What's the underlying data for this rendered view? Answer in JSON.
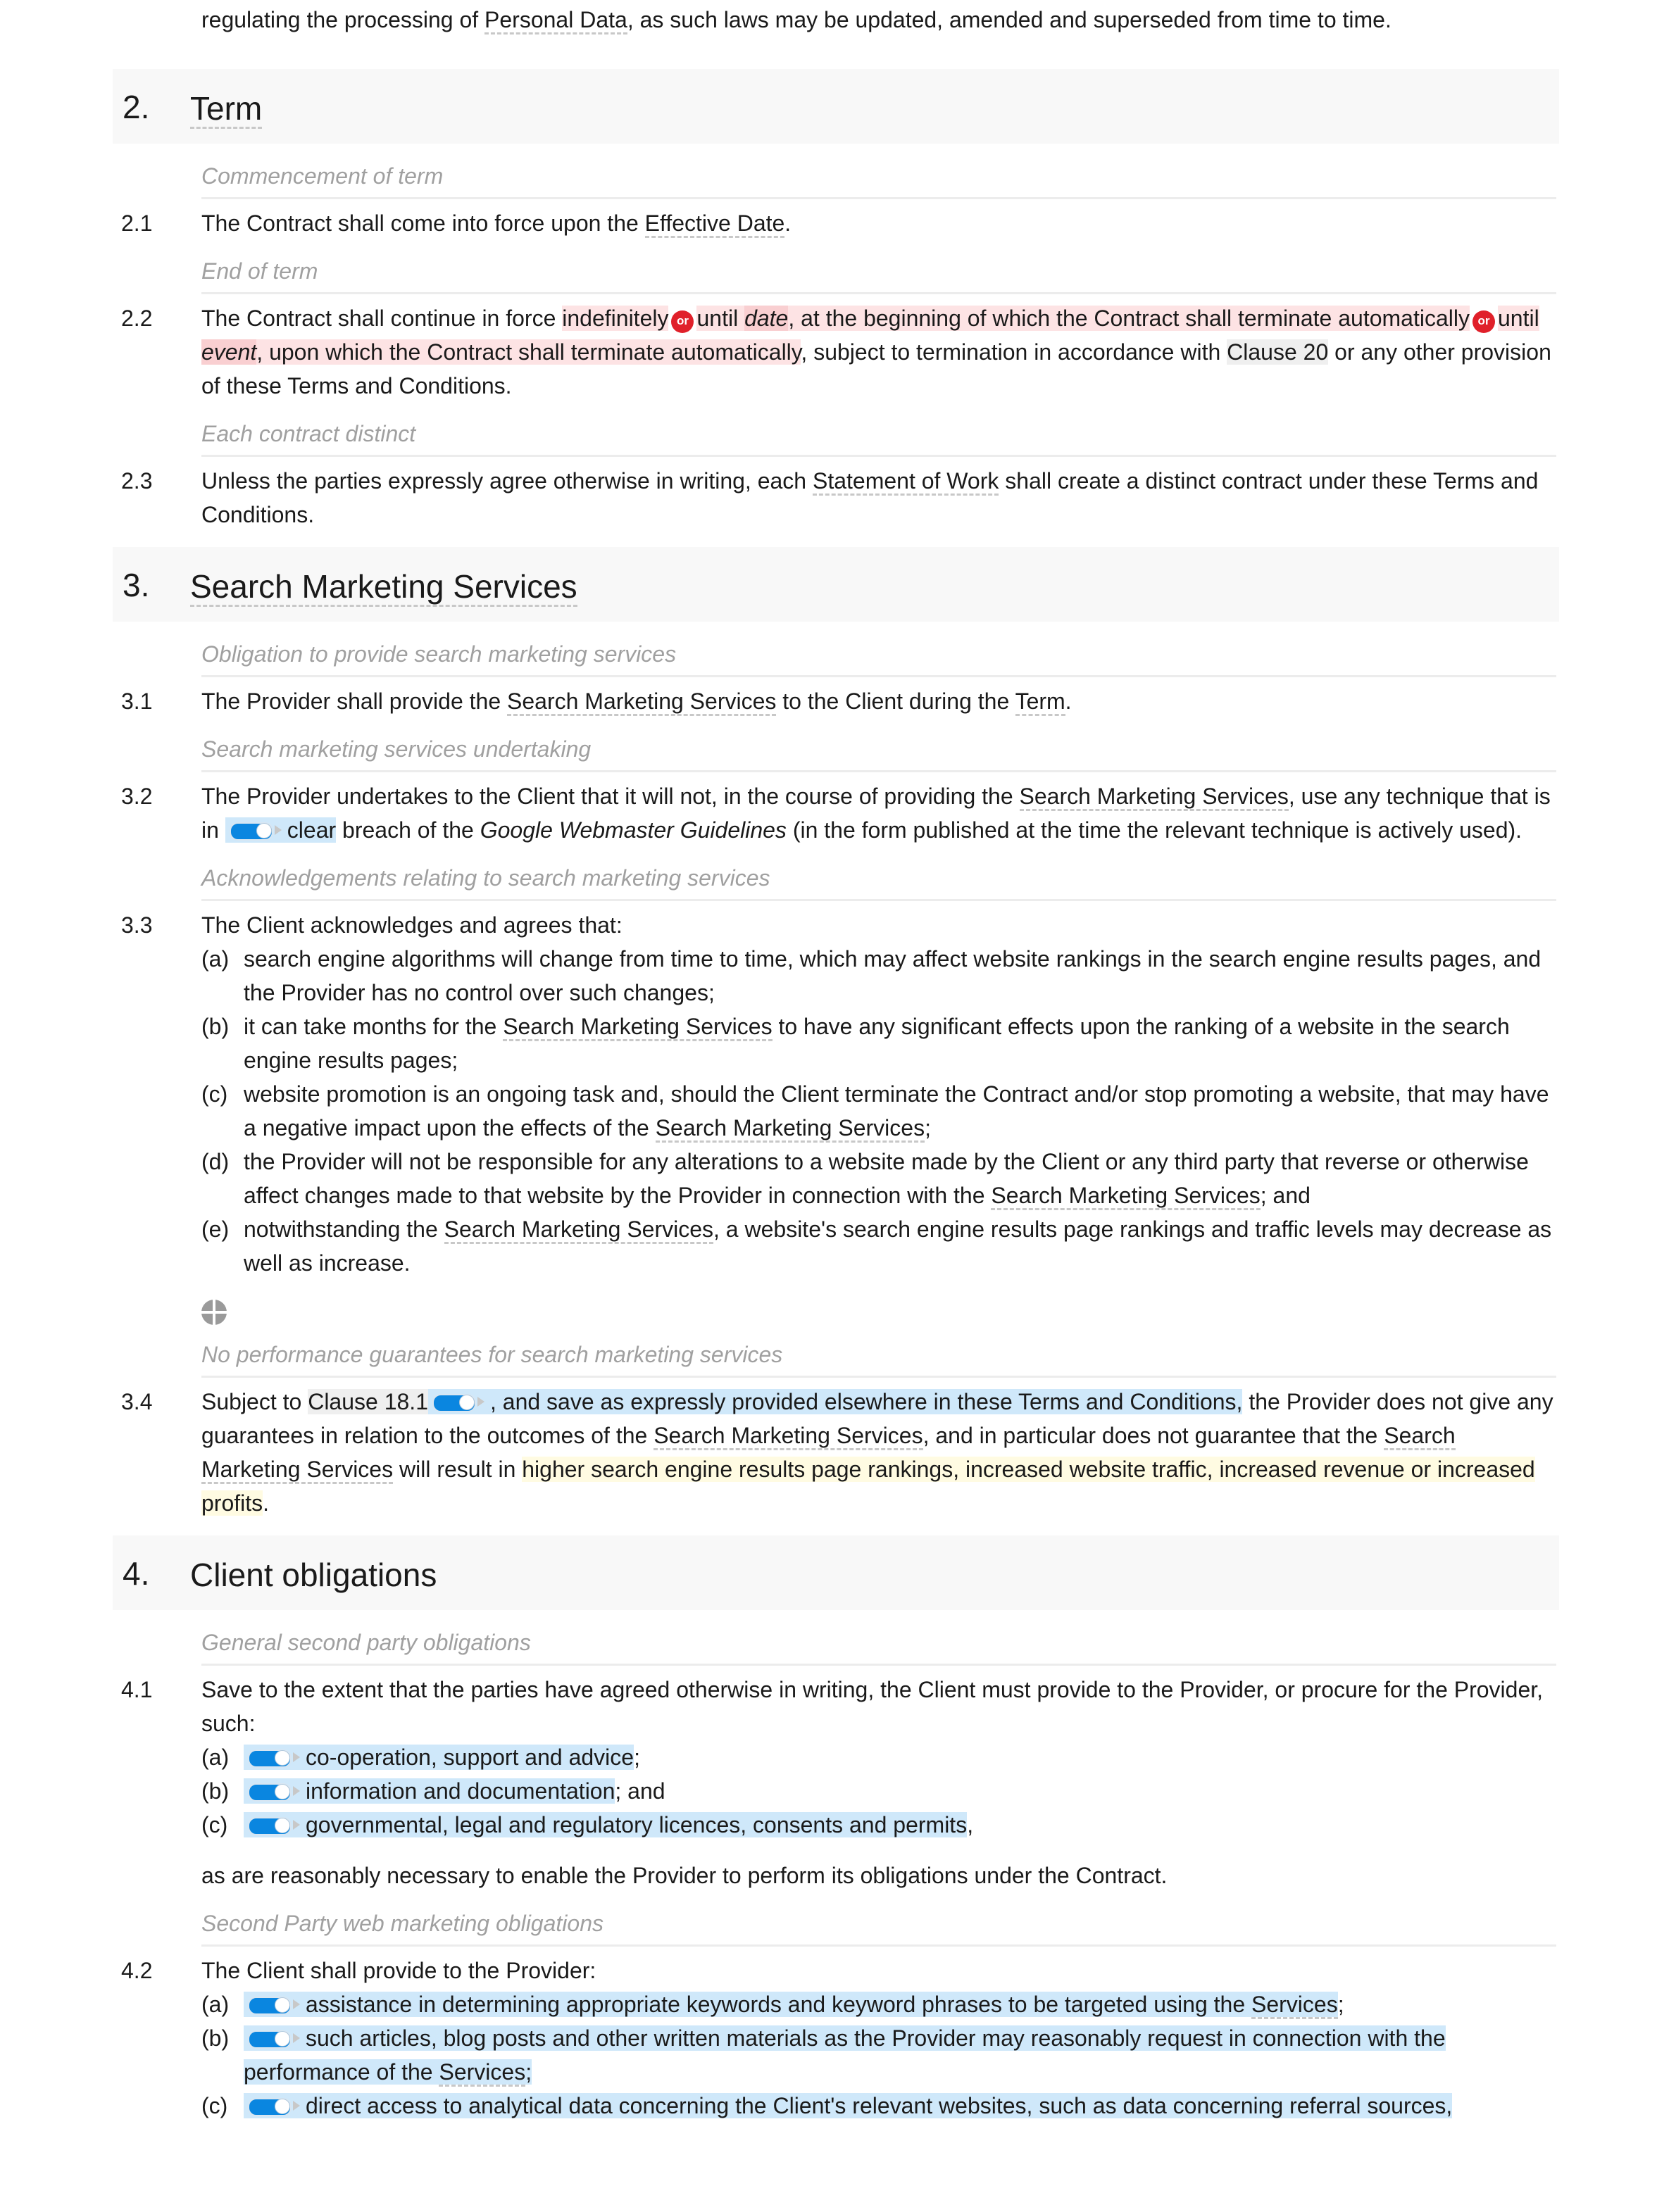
{
  "intro": {
    "pre": "regulating the processing of ",
    "term": "Personal Data",
    "post": ", as such laws may be updated, amended and superseded from time to time."
  },
  "sections": [
    {
      "num": "2.",
      "title": "Term"
    },
    {
      "num": "3.",
      "title": "Search Marketing Services"
    },
    {
      "num": "4.",
      "title": "Client obligations"
    }
  ],
  "s2": {
    "c1": {
      "subhead": "Commencement of term",
      "num": "2.1",
      "pre": "The Contract shall come into force upon the ",
      "term": "Effective Date",
      "post": "."
    },
    "c2": {
      "subhead": "End of term",
      "num": "2.2",
      "t1": "The Contract shall continue in force ",
      "opt1": "indefinitely",
      "or_label": "or",
      "opt2a": "until ",
      "opt2_var": "date",
      "opt2b": ", at the beginning of which the Contract shall terminate automatically",
      "opt3a": "until ",
      "opt3_var": "event",
      "opt3b": ", upon which the Contract shall terminate automatically",
      "t2": ", subject to termination in accordance with ",
      "ref": "Clause 20",
      "t3": " or any other provision of these Terms and Conditions."
    },
    "c3": {
      "subhead": "Each contract distinct",
      "num": "2.3",
      "pre": "Unless the parties expressly agree otherwise in writing, each ",
      "term": "Statement of Work",
      "post": " shall create a distinct contract under these Terms and Conditions."
    }
  },
  "s3": {
    "c1": {
      "subhead": "Obligation to provide search marketing services",
      "num": "3.1",
      "pre": "The Provider shall provide the ",
      "term1": "Search Marketing Services",
      "mid": " to the Client during the ",
      "term2": "Term",
      "post": "."
    },
    "c2": {
      "subhead": "Search marketing services undertaking",
      "num": "3.2",
      "pre": "The Provider undertakes to the Client that it will not, in the course of providing the ",
      "term": "Search Marketing Services",
      "mid": ", use any technique that is in ",
      "opt": "clear",
      "post1": " breach of the ",
      "italic": "Google Webmaster Guidelines",
      "post2": " (in the form published at the time the relevant technique is actively used)."
    },
    "c3": {
      "subhead": "Acknowledgements relating to search marketing services",
      "num": "3.3",
      "intro": "The Client acknowledges and agrees that:",
      "items": [
        {
          "label": "(a)",
          "pre": "search engine algorithms will change from time to time, which may affect website rankings in the search engine results pages, and the Provider has no control over such changes;",
          "term": "",
          "post": ""
        },
        {
          "label": "(b)",
          "pre": "it can take months for the ",
          "term": "Search Marketing Services",
          "post": " to have any significant effects upon the ranking of a website in the search engine results pages;"
        },
        {
          "label": "(c)",
          "pre": "website promotion is an ongoing task and, should the Client terminate the Contract and/or stop promoting a website, that may have a negative impact upon the effects of the ",
          "term": "Search Marketing Services",
          "post": ";"
        },
        {
          "label": "(d)",
          "pre": "the Provider will not be responsible for any alterations to a website made by the Client or any third party that reverse or otherwise affect changes made to that website by the Provider in connection with the ",
          "term": "Search Marketing Services",
          "post": "; and"
        },
        {
          "label": "(e)",
          "pre": "notwithstanding the ",
          "term": "Search Marketing Services",
          "post": ", a website's search engine results page rankings and traffic levels may decrease as well as increase."
        }
      ]
    },
    "c4": {
      "subhead": "No performance guarantees for search marketing services",
      "num": "3.4",
      "pre": "Subject to ",
      "ref": "Clause 18.1",
      "opt": ", and save as expressly provided elsewhere in these Terms and Conditions,",
      "mid1": " the Provider does not give any guarantees in relation to the outcomes of the ",
      "term1": "Search Marketing Services",
      "mid2": ", and in particular does not guarantee that the ",
      "term2": "Search Marketing Services",
      "mid3": " will result in ",
      "highlight": "higher search engine results page rankings, increased website traffic, increased revenue or increased profits",
      "post": "."
    }
  },
  "s4": {
    "c1": {
      "subhead": "General second party obligations",
      "num": "4.1",
      "intro": "Save to the extent that the parties have agreed otherwise in writing, the Client must provide to the Provider, or procure for the Provider, such:",
      "items": [
        {
          "label": "(a)",
          "text": "co-operation, support and advice",
          "post": ";"
        },
        {
          "label": "(b)",
          "text": "information and documentation",
          "post": "; and"
        },
        {
          "label": "(c)",
          "text": "governmental, legal and regulatory licences, consents and permits",
          "post": ","
        }
      ],
      "outro": "as are reasonably necessary to enable the Provider to perform its obligations under the Contract."
    },
    "c2": {
      "subhead": "Second Party web marketing obligations",
      "num": "4.2",
      "intro": "The Client shall provide to the Provider:",
      "items": [
        {
          "label": "(a)",
          "text": "assistance in determining appropriate keywords and keyword phrases to be targeted using the ",
          "term": "Services",
          "post": ";"
        },
        {
          "label": "(b)",
          "text": "such articles, blog posts and other written materials as the Provider may reasonably request in connection with the performance of the ",
          "term": "Services",
          "post": ";"
        },
        {
          "label": "(c)",
          "text": "direct access to analytical data concerning the Client's relevant websites, such as data concerning referral sources,",
          "term": "",
          "post": ""
        }
      ]
    }
  }
}
